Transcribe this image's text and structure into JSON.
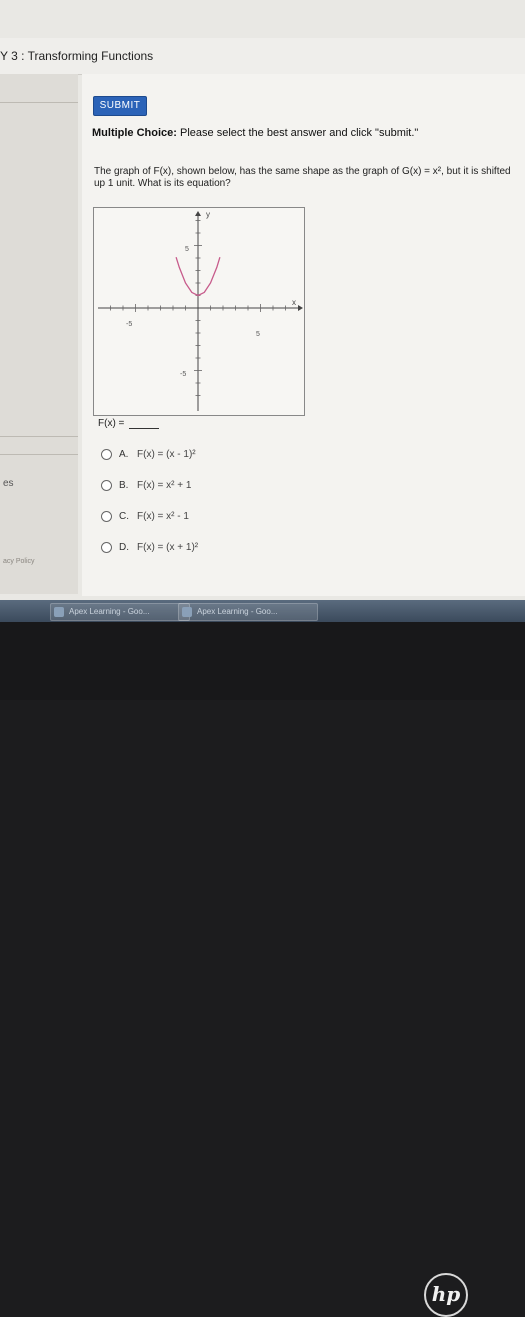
{
  "window": {
    "title": "Y 3 : Transforming Functions"
  },
  "actions": {
    "submit_label": "SUBMIT"
  },
  "instructions": {
    "lead": "Multiple Choice:",
    "text": " Please select the best answer and click \"submit.\""
  },
  "question": {
    "line1": "The graph of F(x), shown below, has the same shape as the graph of G(x) = x², but it is shifted up 1 unit. What is its equation?"
  },
  "chart_data": {
    "type": "line",
    "series": [
      {
        "x": [
          -1.75,
          -1.5,
          -1,
          -0.5,
          0,
          0.5,
          1,
          1.5,
          1.75
        ],
        "y": [
          4.0625,
          3.25,
          2,
          1.25,
          1,
          1.25,
          2,
          3.25,
          4.0625
        ]
      }
    ],
    "xlabel": "x",
    "ylabel": "y",
    "xlim": [
      -8,
      8
    ],
    "ylim": [
      -8,
      8
    ],
    "x_ticks_labeled": [
      "-5",
      "5"
    ],
    "y_ticks_labeled": [
      "5",
      "-5"
    ],
    "curve_color": "#c75b8b",
    "grid": false
  },
  "answer": {
    "prompt": "F(x) ="
  },
  "options": [
    {
      "letter": "A.",
      "equation": "F(x) = (x - 1)²"
    },
    {
      "letter": "B.",
      "equation": "F(x) = x² + 1"
    },
    {
      "letter": "C.",
      "equation": "F(x) = x² - 1"
    },
    {
      "letter": "D.",
      "equation": "F(x) = (x + 1)²"
    }
  ],
  "side": {
    "partial_label": "es",
    "privacy": "acy Policy"
  },
  "taskbar": {
    "items": [
      {
        "label": "Apex Learning - Goo..."
      },
      {
        "label": "Apex Learning - Goo..."
      }
    ]
  },
  "brand": {
    "logo": "hp"
  }
}
